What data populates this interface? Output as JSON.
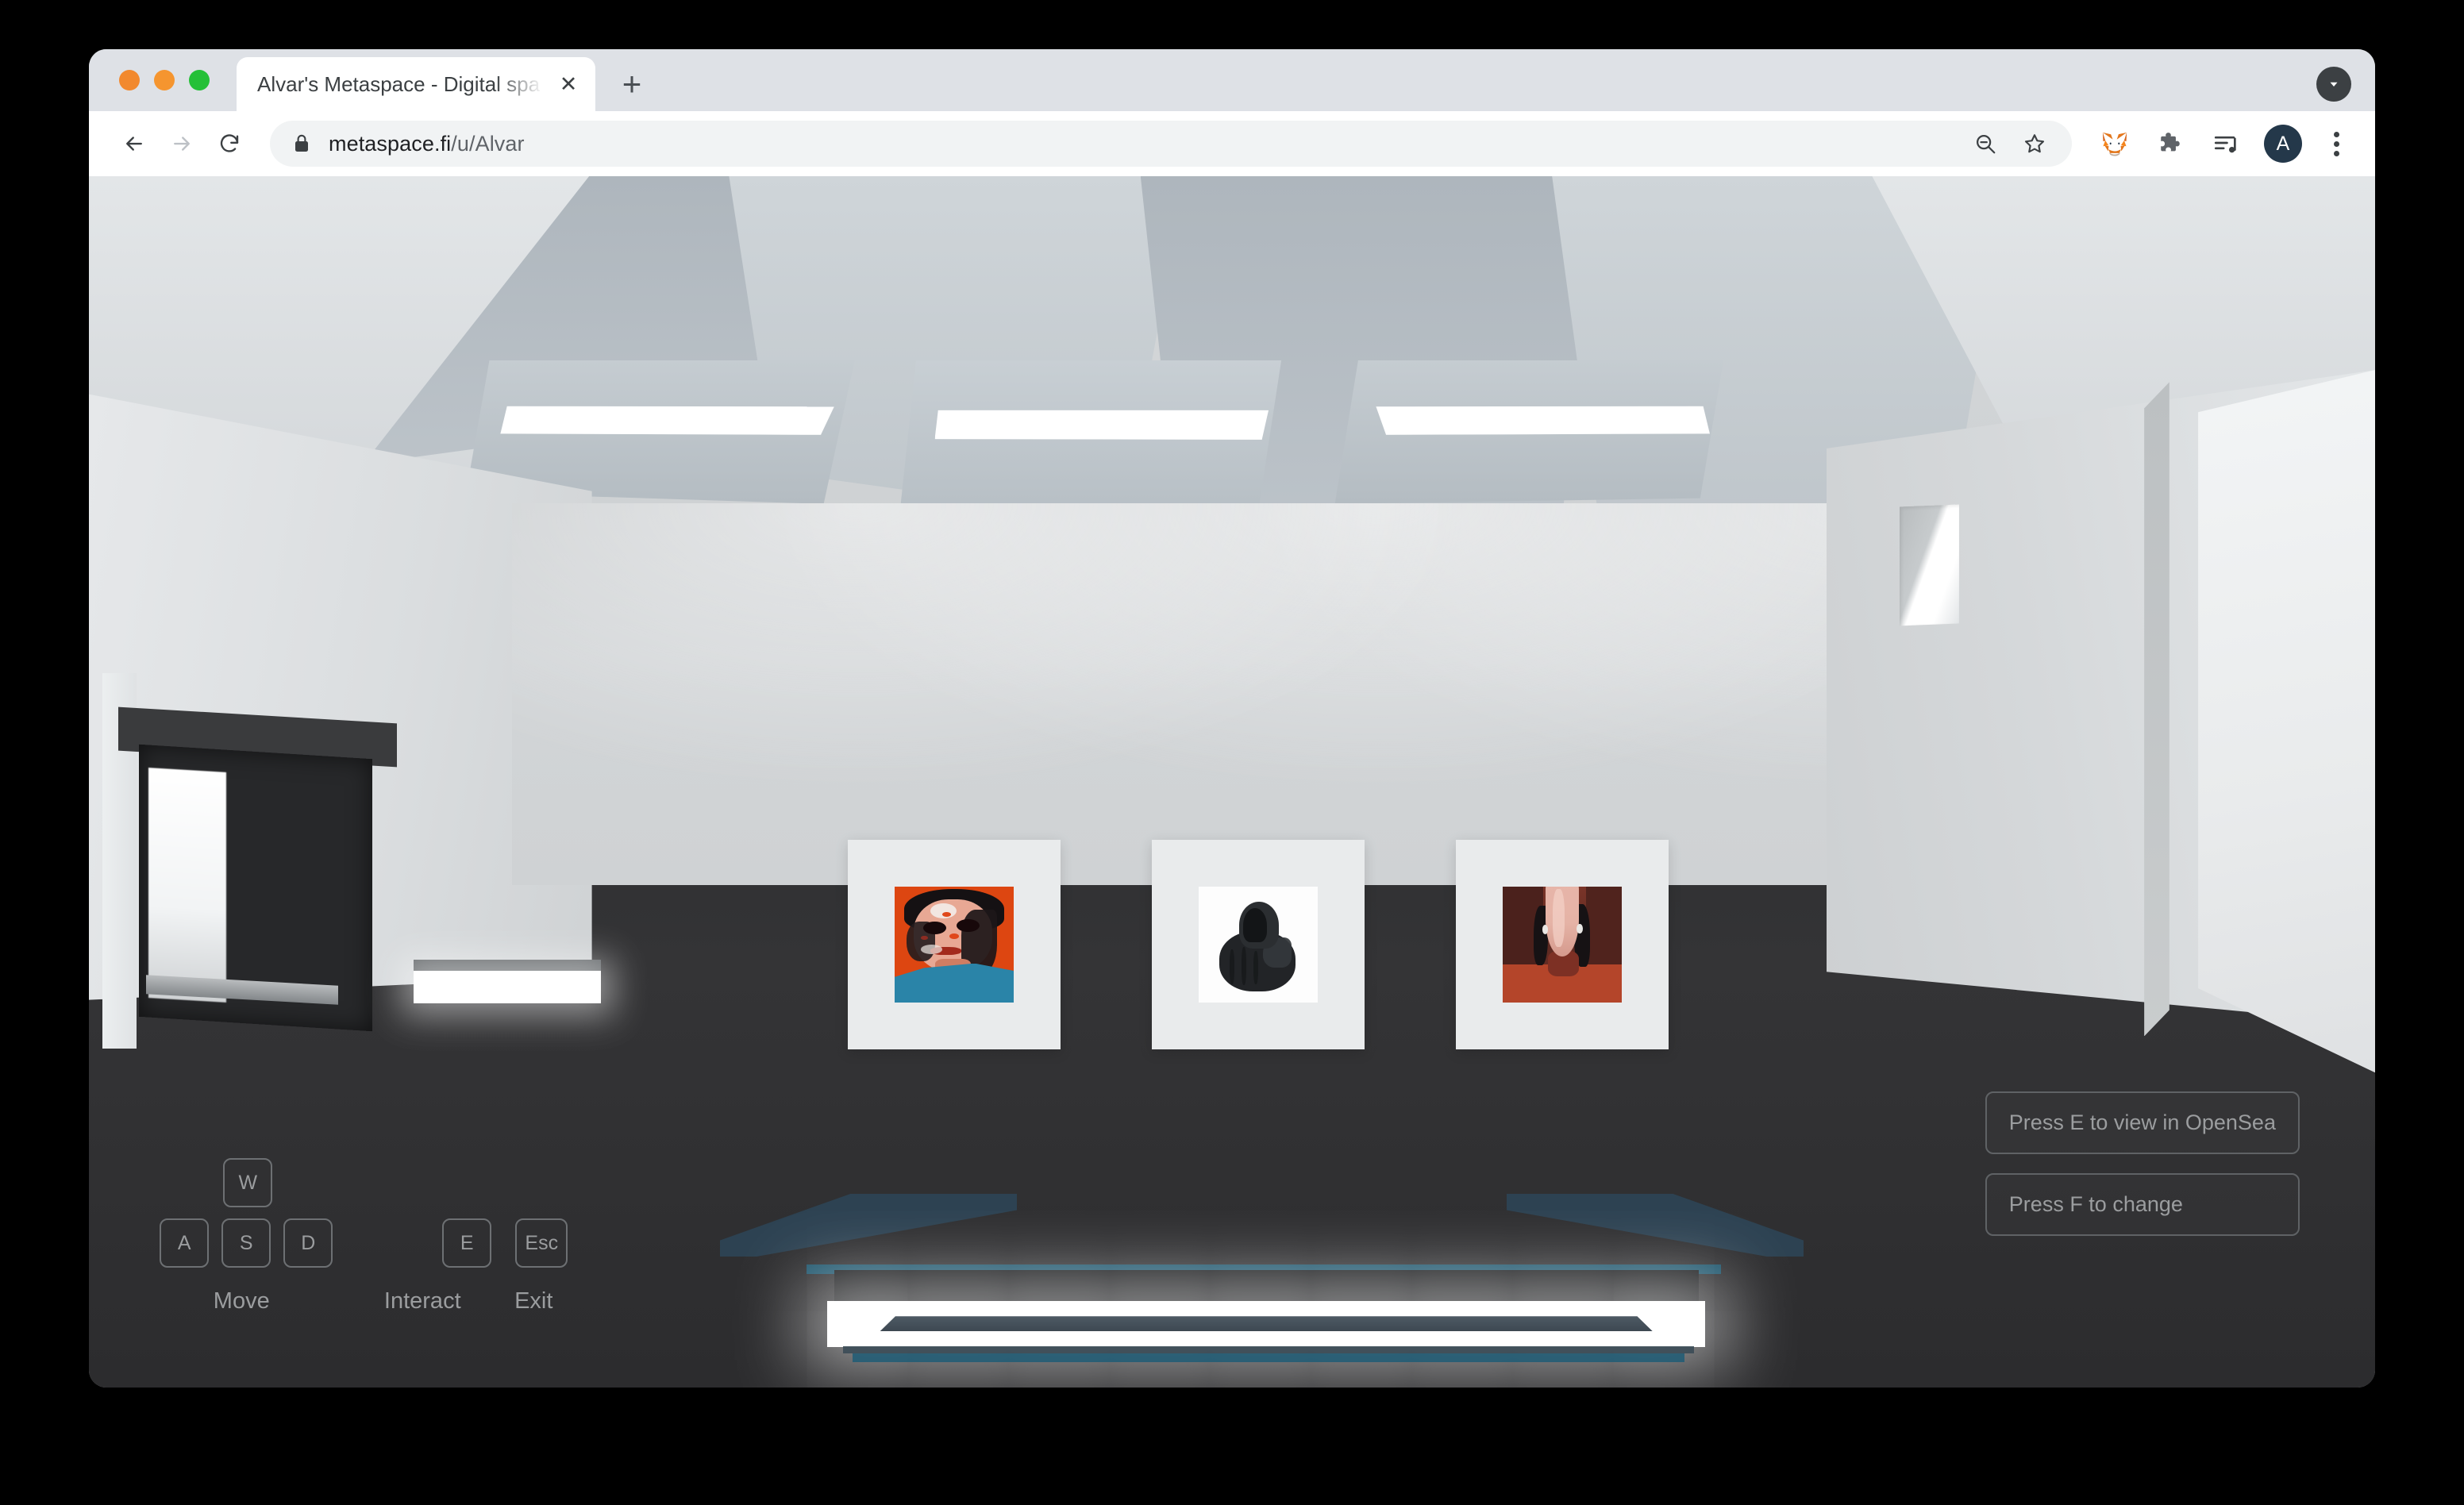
{
  "browser": {
    "traffic_lights": [
      {
        "name": "close",
        "color": "#f2892e"
      },
      {
        "name": "minimize",
        "color": "#f5952f"
      },
      {
        "name": "maximize",
        "color": "#24c037"
      }
    ],
    "tab": {
      "title": "Alvar's Metaspace - Digital spa",
      "close_label": "✕"
    },
    "new_tab_label": "+",
    "tab_search_icon": "chevron-down-icon",
    "toolbar": {
      "back_icon": "arrow-left-icon",
      "forward_icon": "arrow-right-icon",
      "reload_icon": "reload-icon",
      "lock_icon": "lock-icon",
      "url_domain": "metaspace.fi",
      "url_path": "/u/Alvar",
      "zoom_out_icon": "zoom-out-icon",
      "bookmark_icon": "star-icon",
      "metamask_icon": "metamask-fox-icon",
      "extensions_icon": "puzzle-piece-icon",
      "media_icon": "media-playlist-icon",
      "avatar_initial": "A",
      "menu_icon": "kebab-menu-icon"
    }
  },
  "scene": {
    "name": "virtual-gallery-room",
    "artworks": [
      {
        "id": "artwork-1",
        "title": "Orange Expressionist Portrait"
      },
      {
        "id": "artwork-2",
        "title": "Hooded Figure"
      },
      {
        "id": "artwork-3",
        "title": "Inverted Face in Maroon"
      }
    ]
  },
  "hud": {
    "keys": {
      "up": "W",
      "left": "A",
      "down": "S",
      "right": "D",
      "interact": "E",
      "exit": "Esc"
    },
    "captions": {
      "move": "Move",
      "interact": "Interact",
      "exit": "Exit"
    },
    "prompts": [
      "Press E to view in OpenSea",
      "Press F to change"
    ]
  },
  "colors": {
    "hud_text": "#9b9d9f",
    "hud_border": "#6d7073",
    "floor": "#2e2f31",
    "wall": "#cfd2d4",
    "podium_accent": "#1e5c75",
    "avatar_bg": "#24384a"
  }
}
